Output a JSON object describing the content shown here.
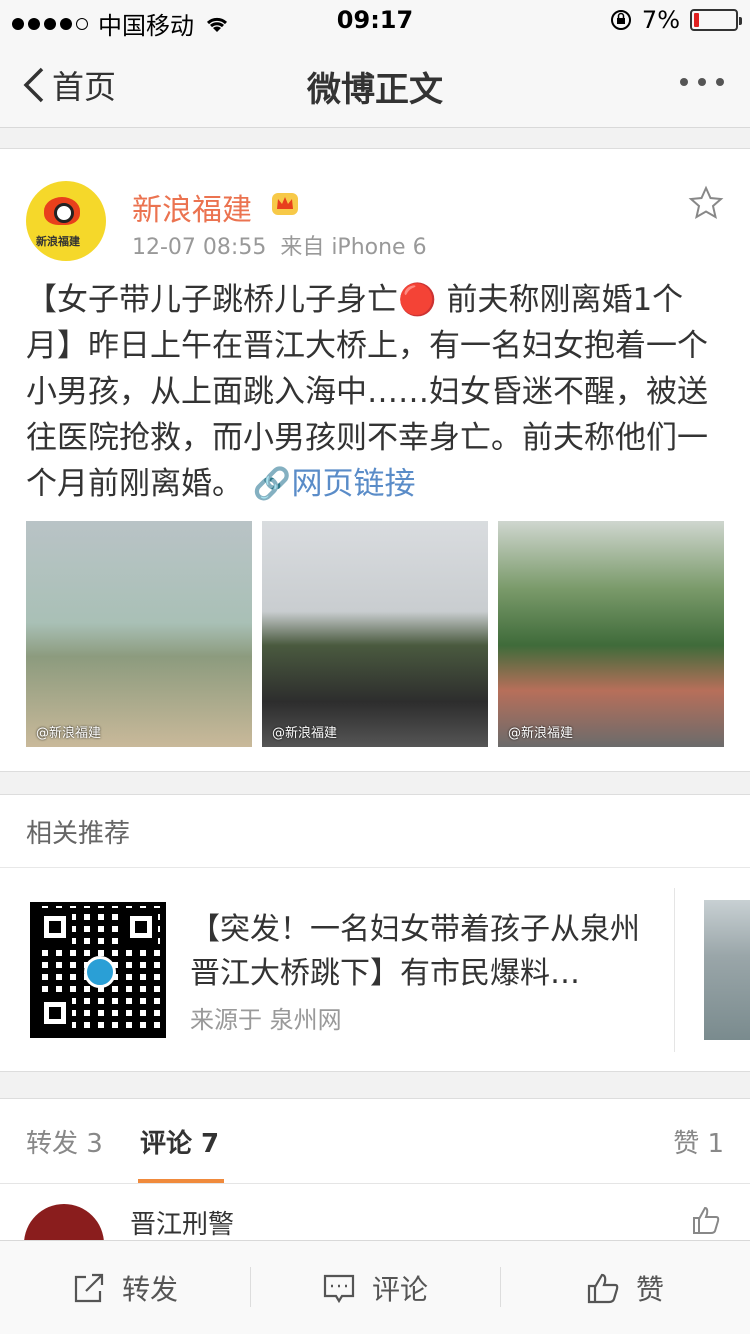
{
  "status_bar": {
    "carrier": "中国移动",
    "time": "09:17",
    "battery": "7%",
    "battery_level": 0.07
  },
  "nav": {
    "back_label": "首页",
    "title": "微博正文"
  },
  "post": {
    "username": "新浪福建",
    "avatar_text": "新浪福建",
    "time": "12-07 08:55",
    "source": "来自 iPhone 6",
    "text": "【女子带儿子跳桥儿子身亡🔴 前夫称刚离婚1个月】昨日上午在晋江大桥上，有一名妇女抱着一个小男孩，从上面跳入海中……妇女昏迷不醒，被送往医院抢救，而小男孩则不幸身亡。前夫称他们一个月前刚离婚。",
    "link_text": "网页链接",
    "photos": [
      {
        "watermark": "@新浪福建"
      },
      {
        "watermark": "@新浪福建"
      },
      {
        "watermark": "@新浪福建"
      }
    ]
  },
  "related": {
    "heading": "相关推荐",
    "title": "【突发！一名妇女带着孩子从泉州晋江大桥跳下】有市民爆料…",
    "source": "来源于 泉州网"
  },
  "tabs": {
    "repost": "转发 3",
    "comment": "评论 7",
    "like": "赞 1"
  },
  "comment": {
    "name": "晋江刑警"
  },
  "toolbar": {
    "repost": "转发",
    "comment": "评论",
    "like": "赞"
  },
  "colors": {
    "username": "#eb7350",
    "link": "#5a8cc8",
    "tab_accent": "#f08a3c"
  }
}
